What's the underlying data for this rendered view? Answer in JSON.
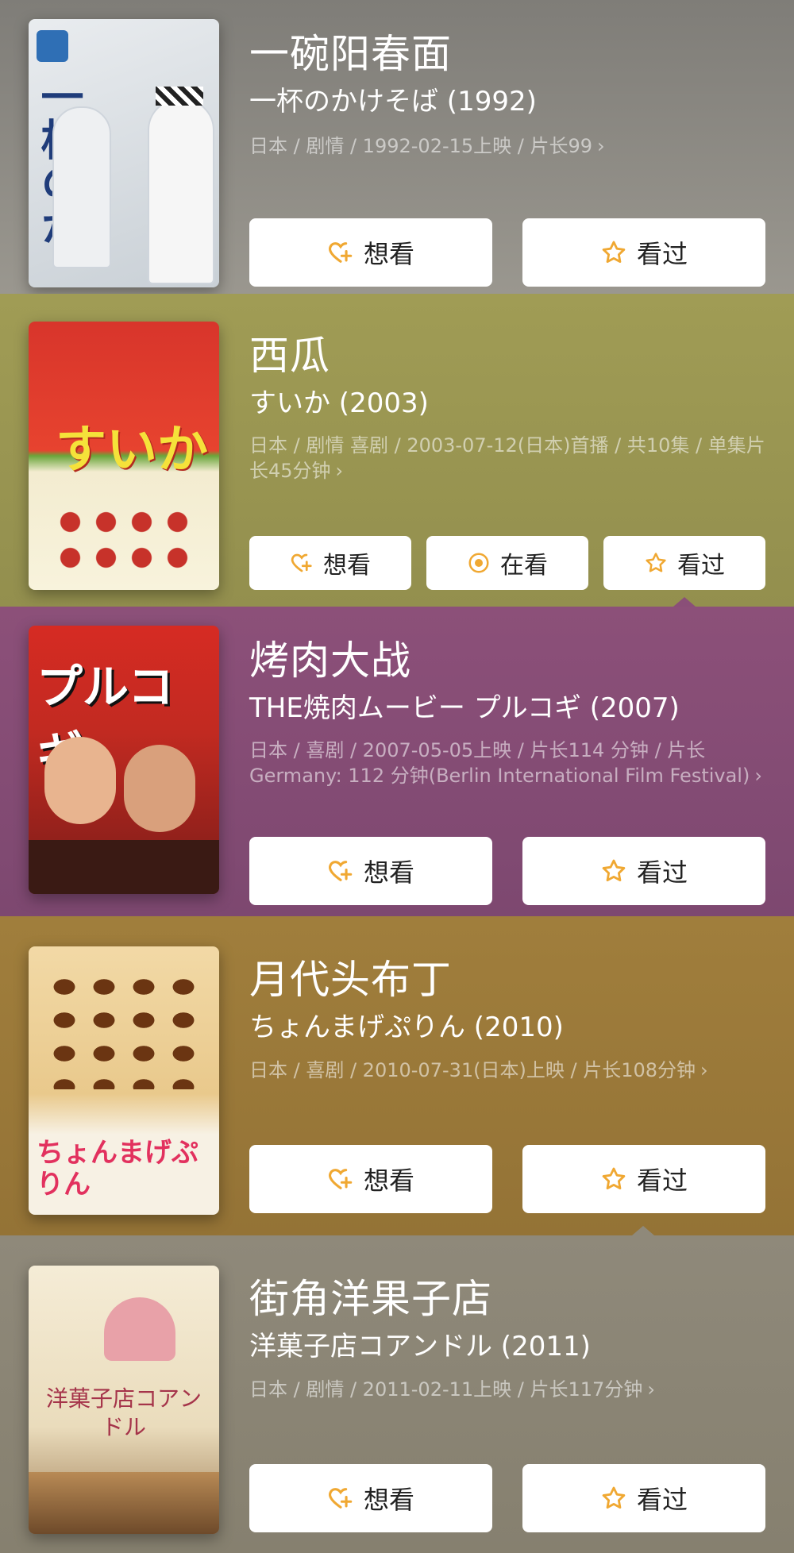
{
  "accent": "#f0a832",
  "movies": [
    {
      "title": "一碗阳春面",
      "subtitle": "一杯のかけそば (1992)",
      "meta": "日本 / 剧情 / 1992-02-15上映 / 片长99",
      "background": "#8d8a84",
      "buttons": [
        "想看",
        "看过"
      ],
      "poster_text": "一杯のかけそば"
    },
    {
      "title": "西瓜",
      "subtitle": "すいか (2003)",
      "meta": "日本 / 剧情 喜剧 / 2003-07-12(日本)首播 / 共10集 / 单集片长45分钟",
      "background": "#9e9a52",
      "buttons": [
        "想看",
        "在看",
        "看过"
      ],
      "poster_text": "すいか"
    },
    {
      "title": "烤肉大战",
      "subtitle": "THE焼肉ムービー プルコギ (2007)",
      "meta": "日本 / 喜剧 / 2007-05-05上映 / 片长114 分钟 / 片长 Germany: 112 分钟(Berlin International Film Festival)",
      "background": "#8a4f78",
      "buttons": [
        "想看",
        "看过"
      ],
      "poster_text": "プルコギ"
    },
    {
      "title": "月代头布丁",
      "subtitle": "ちょんまげぷりん (2010)",
      "meta": "日本 / 喜剧 / 2010-07-31(日本)上映 / 片长108分钟",
      "background": "#9b7b3a",
      "buttons": [
        "想看",
        "看过"
      ],
      "poster_text": "ちょんまげぷりん"
    },
    {
      "title": "街角洋果子店",
      "subtitle": "洋菓子店コアンドル (2011)",
      "meta": "日本 / 剧情 / 2011-02-11上映 / 片长117分钟",
      "background": "#8f897a",
      "buttons": [
        "想看",
        "看过"
      ],
      "poster_text": "洋菓子店コアンドル"
    }
  ]
}
